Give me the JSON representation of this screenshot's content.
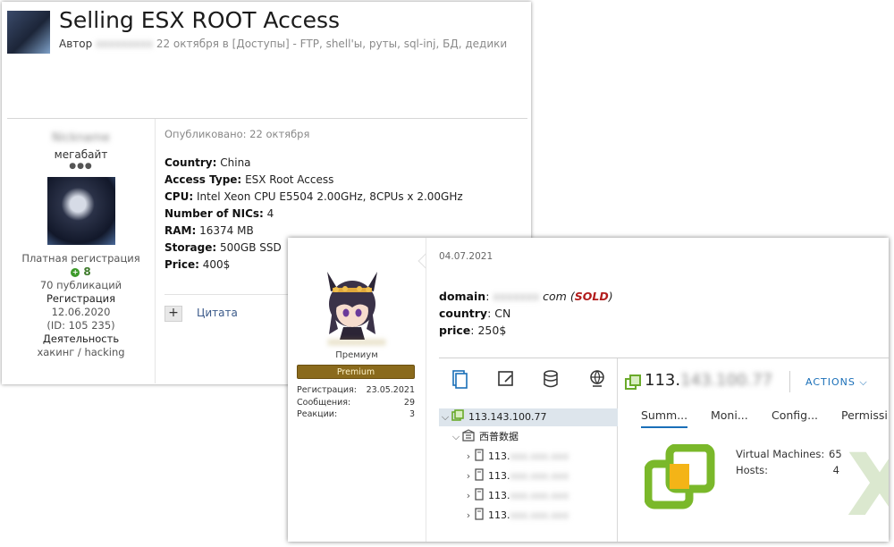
{
  "thread": {
    "title": "Selling ESX ROOT Access",
    "author_label": "Автор",
    "author_name": "xxxxxxxxx",
    "meta_rest": "22 октября в [Доступы] - FTP, shell'ы, руты, sql-inj, БД, дедики"
  },
  "post_user": {
    "name": "Nickname",
    "rank": "мегабайт",
    "dots": "●●●",
    "registration_type": "Платная регистрация",
    "reputation": "8",
    "publications": "70 публикаций",
    "registration_label": "Регистрация",
    "registration_date": "12.06.2020",
    "user_id": "(ID: 105 235)",
    "activity_label": "Деятельность",
    "activity": "хакинг / hacking"
  },
  "post": {
    "published": "Опубликовано: 22 октября",
    "specs": [
      {
        "label": "Country:",
        "value": "China"
      },
      {
        "label": "Access Type:",
        "value": "ESX Root Access"
      },
      {
        "label": "CPU:",
        "value": "Intel Xeon CPU E5504 2.00GHz, 8CPUs x 2.00GHz"
      },
      {
        "label": "Number of NICs:",
        "value": "4"
      },
      {
        "label": "RAM:",
        "value": "16374 MB"
      },
      {
        "label": "Storage:",
        "value": "500GB SSD"
      },
      {
        "label": "Price:",
        "value": "400$"
      }
    ],
    "plus": "+",
    "quote": "Цитата"
  },
  "post2_user": {
    "name": "xxxxxxxxxx",
    "role": "Премиум",
    "badge": "Premium",
    "stats": [
      {
        "label": "Регистрация:",
        "value": "23.05.2021"
      },
      {
        "label": "Сообщения:",
        "value": "29"
      },
      {
        "label": "Реакции:",
        "value": "3"
      }
    ]
  },
  "post2": {
    "date": "04.07.2021",
    "domain_label": "domain",
    "domain_blur": "xxxxxxx",
    "domain_tld": "com",
    "sold": "SOLD",
    "country_label": "country",
    "country_value": "CN",
    "price_label": "price",
    "price_value": "250$"
  },
  "vsphere": {
    "tree": {
      "root": "113.143.100.77",
      "datacenter": "西普数据",
      "hosts": [
        "113.",
        "113.",
        "113.",
        "113."
      ],
      "host_blur": "xxx.xxx.xxx"
    },
    "host_title_prefix": "113.",
    "host_title_blur": "143.100.77",
    "actions": "ACTIONS",
    "subtabs": [
      "Summ...",
      "Moni...",
      "Config...",
      "Permissi"
    ],
    "stats": [
      {
        "label": "Virtual Machines:",
        "value": "65"
      },
      {
        "label": "Hosts:",
        "value": "4"
      }
    ],
    "accent": "#1a6fb8"
  }
}
